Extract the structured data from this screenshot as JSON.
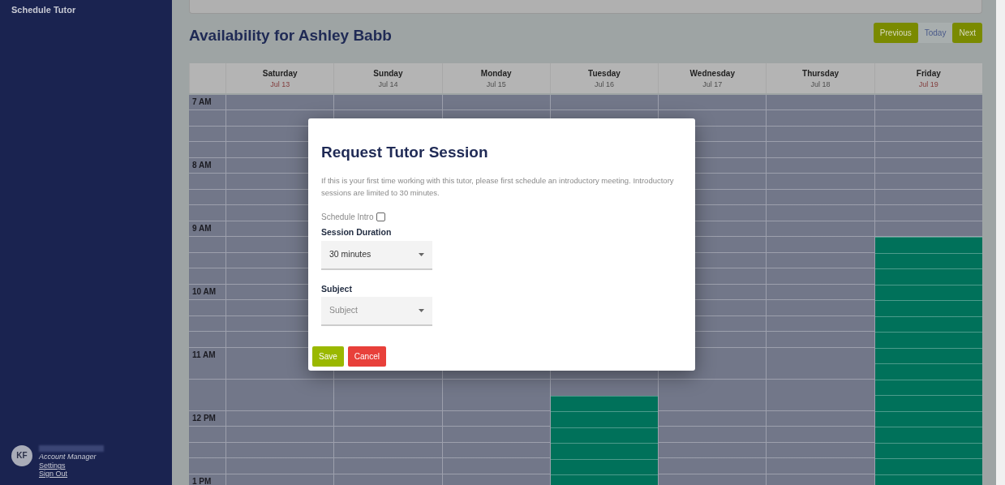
{
  "sidebar": {
    "title": "Schedule Tutor",
    "user": {
      "initials": "KF",
      "role": "Account Manager",
      "links": [
        "Settings",
        "Sign Out"
      ]
    }
  },
  "heading": "Availability for Ashley Babb",
  "nav_buttons": [
    {
      "label": "Previous",
      "kind": "primary"
    },
    {
      "label": "Today",
      "kind": "plain"
    },
    {
      "label": "Next",
      "kind": "primary"
    }
  ],
  "calendar": {
    "times": [
      "7 AM",
      "8 AM",
      "9 AM",
      "10 AM",
      "11 AM",
      "12 PM",
      "1 PM"
    ],
    "days": [
      {
        "name": "Saturday",
        "date": "Jul 13",
        "highlighted": true
      },
      {
        "name": "Sunday",
        "date": "Jul 14",
        "highlighted": false
      },
      {
        "name": "Monday",
        "date": "Jul 15",
        "highlighted": false
      },
      {
        "name": "Tuesday",
        "date": "Jul 16",
        "highlighted": false,
        "level": 0.32
      },
      {
        "name": "Wednesday",
        "date": "Jul 17",
        "highlighted": false
      },
      {
        "name": "Thursday",
        "date": "Jul 18",
        "highlighted": false
      },
      {
        "name": "Friday",
        "date": "Jul 19",
        "highlighted": true,
        "level": 0.68
      }
    ]
  },
  "modal": {
    "title": "Request Tutor Session",
    "description": "If this is your first time working with this tutor, please first schedule an introductory meeting. Introductory sessions are limited to 30 minutes.",
    "intro_checkbox": {
      "label": "Schedule Intro",
      "checked": false
    },
    "fields": [
      {
        "label": "Session Duration",
        "value": "30 minutes"
      },
      {
        "label": "Subject",
        "placeholder": "Subject"
      }
    ],
    "buttons": [
      {
        "label": "Save",
        "kind": "save"
      },
      {
        "label": "Cancel",
        "kind": "cancel"
      }
    ]
  }
}
